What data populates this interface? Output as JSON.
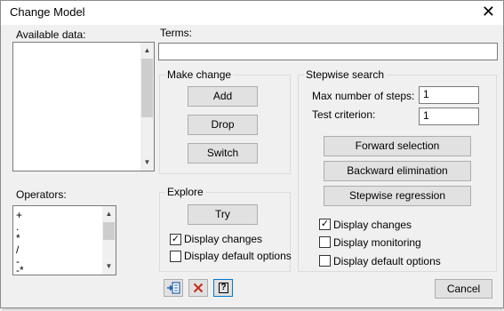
{
  "window": {
    "title": "Change Model",
    "close_glyph": "✕"
  },
  "available_data": {
    "label": "Available data:"
  },
  "terms": {
    "label": "Terms:",
    "value": ""
  },
  "operators": {
    "label": "Operators:",
    "items": [
      "+",
      ".",
      "*",
      "/",
      "-",
      "-*"
    ]
  },
  "make_change": {
    "title": "Make change",
    "add": "Add",
    "drop": "Drop",
    "switch": "Switch"
  },
  "explore": {
    "title": "Explore",
    "try": "Try",
    "display_changes": "Display changes",
    "display_default_options": "Display default options",
    "display_changes_checked": true,
    "display_default_options_checked": false
  },
  "stepwise": {
    "title": "Stepwise search",
    "max_steps_label": "Max number of steps:",
    "max_steps_value": "1",
    "test_criterion_label": "Test criterion:",
    "test_criterion_value": "1",
    "forward": "Forward selection",
    "backward": "Backward elimination",
    "stepwise_regression": "Stepwise regression",
    "display_changes": "Display changes",
    "display_monitoring": "Display monitoring",
    "display_default_options": "Display default options",
    "display_changes_checked": true,
    "display_monitoring_checked": false,
    "display_default_options_checked": false
  },
  "footer": {
    "cancel": "Cancel",
    "help_glyph": "?"
  },
  "colors": {
    "dialog_bg": "#f0f0f0",
    "button_bg": "#e1e1e1",
    "focus_border": "#0078d7",
    "red_x": "#c42b1c",
    "icon_blue": "#1f5fa8"
  }
}
